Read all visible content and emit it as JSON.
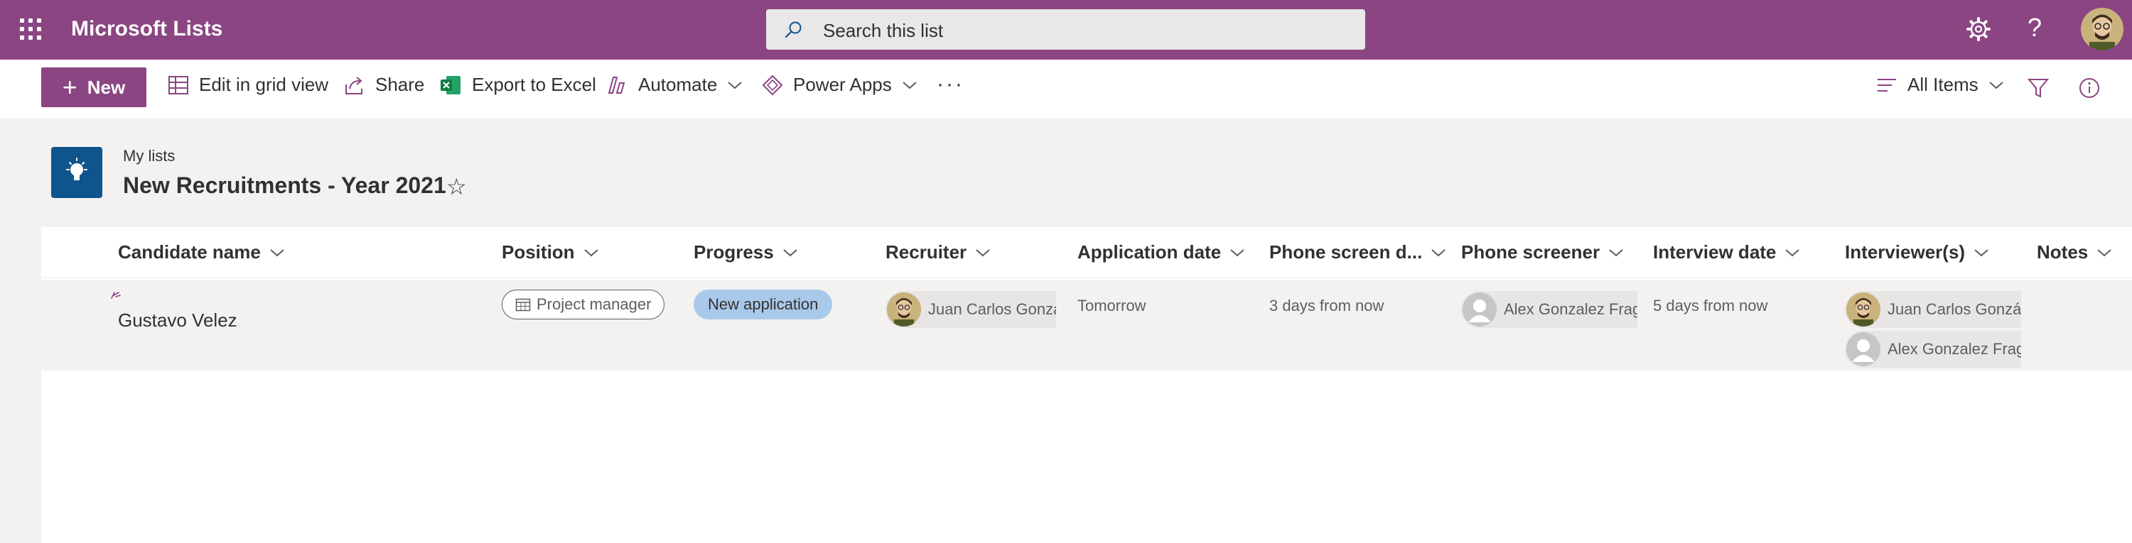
{
  "suitebar": {
    "app_title": "Microsoft Lists",
    "search_placeholder": "Search this list",
    "help_glyph": "?",
    "icons": [
      "waffle-icon",
      "search-icon",
      "gear-icon",
      "help-icon",
      "avatar"
    ]
  },
  "commandbar": {
    "new_label": "New",
    "edit_grid_label": "Edit in grid view",
    "share_label": "Share",
    "export_label": "Export to Excel",
    "automate_label": "Automate",
    "powerapps_label": "Power Apps",
    "more_label": "···",
    "view_label": "All Items"
  },
  "header": {
    "breadcrumb": "My lists",
    "title": "New Recruitments - Year 2021",
    "favorite_glyph": "☆"
  },
  "columns": [
    "Candidate name",
    "Position",
    "Progress",
    "Recruiter",
    "Application date",
    "Phone screen d...",
    "Phone screener",
    "Interview date",
    "Interviewer(s)",
    "Notes"
  ],
  "rows": [
    {
      "candidate_name": "Gustavo Velez",
      "position": "Project manager",
      "progress": "New application",
      "recruiter": "Juan Carlos Gonzále",
      "application_date": "Tomorrow",
      "phone_screen_date": "3 days from now",
      "phone_screener": "Alex Gonzalez Fraga",
      "interview_date": "5 days from now",
      "interviewers": [
        "Juan Carlos Gonzále",
        "Alex Gonzalez Fraga"
      ]
    }
  ],
  "colors": {
    "brand": "#8a4582",
    "progress_pill": "#a9c9eb",
    "list_icon_bg": "#0f548c",
    "excel_green": "#107c41"
  }
}
